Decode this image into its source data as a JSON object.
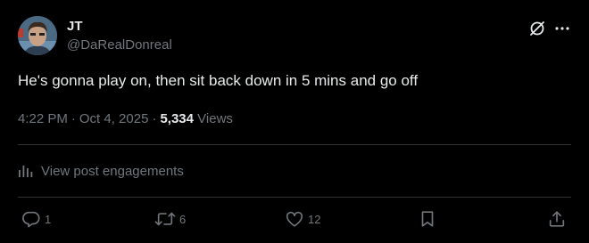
{
  "author": {
    "name": "JT",
    "handle": "@DaRealDonreal"
  },
  "post": {
    "text": "He's gonna play on, then sit back down in 5 mins and go off",
    "time": "4:22 PM",
    "separator": "·",
    "date": "Oct 4, 2025",
    "views_count": "5,334",
    "views_label": "Views"
  },
  "engagements_link": "View post engagements",
  "actions": {
    "replies": "1",
    "reposts": "6",
    "likes": "12"
  },
  "icons": {
    "grok": "grok-icon",
    "more": "more-icon",
    "engagements": "bar-chart-icon",
    "reply": "reply-icon",
    "repost": "repost-icon",
    "like": "heart-icon",
    "bookmark": "bookmark-icon",
    "share": "share-icon"
  },
  "colors": {
    "background": "#000000",
    "text_primary": "#e7e9ea",
    "text_secondary": "#71767b",
    "divider": "#2f3336"
  }
}
